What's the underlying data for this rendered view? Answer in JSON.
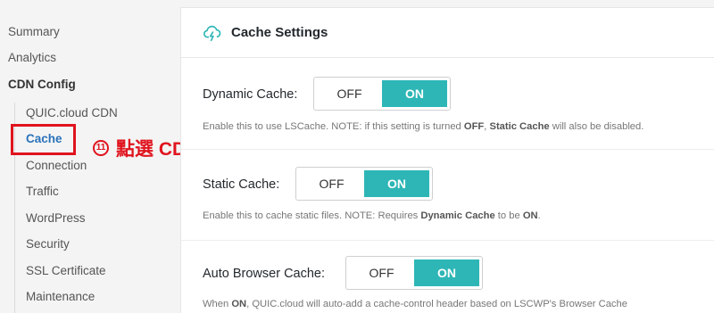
{
  "sidebar": {
    "items": [
      "Summary",
      "Analytics",
      "CDN Config"
    ],
    "sub_items": [
      "QUIC.cloud CDN",
      "Cache",
      "Connection",
      "Traffic",
      "WordPress",
      "Security",
      "SSL Certificate",
      "Maintenance"
    ],
    "active": "Cache"
  },
  "annotation": {
    "number": "11",
    "text": "點選 CDN Config 下的 Cache",
    "color": "#e0141e"
  },
  "panel": {
    "title": "Cache Settings",
    "accent_color": "#2eb6b6",
    "settings": [
      {
        "label": "Dynamic Cache:",
        "off_label": "OFF",
        "on_label": "ON",
        "value": "ON",
        "desc_parts": [
          "Enable this to use LSCache. NOTE: if this setting is turned ",
          "OFF",
          ", ",
          "Static Cache",
          " will also be disabled."
        ]
      },
      {
        "label": "Static Cache:",
        "off_label": "OFF",
        "on_label": "ON",
        "value": "ON",
        "desc_parts": [
          "Enable this to cache static files. NOTE: Requires ",
          "Dynamic Cache",
          " to be ",
          "ON",
          "."
        ]
      },
      {
        "label": "Auto Browser Cache:",
        "off_label": "OFF",
        "on_label": "ON",
        "value": "ON",
        "desc_parts": [
          "When ",
          "ON",
          ", QUIC.cloud will auto-add a cache-control header based on LSCWP's Browser Cache"
        ]
      }
    ]
  }
}
